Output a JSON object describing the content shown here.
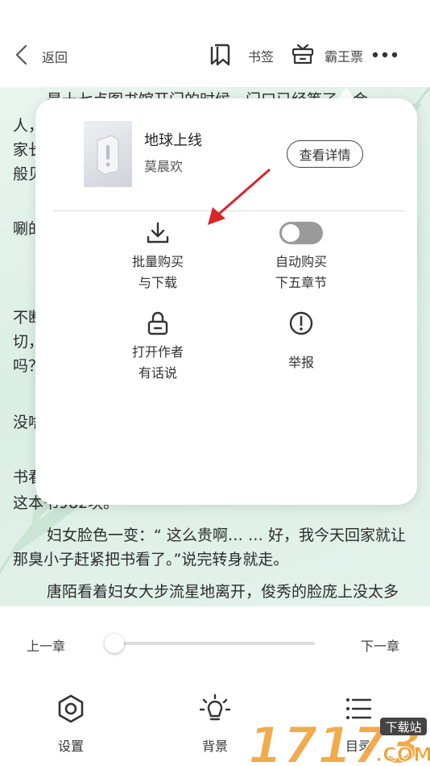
{
  "topbar": {
    "back_label": "返回",
    "bookmark_label": "书签",
    "ticket_label": "霸王票"
  },
  "reading": {
    "lines": [
      "是十七点图书馆开门的时候，门口已经等了一会",
      "人，",
      "家长",
      "般见",
      "唰的",
      "不断",
      "切，",
      "吗？",
      "没啥",
      "书看",
      "这本书982块。",
      "妇女脸色一变：“ 这么贵啊… … 好，我今天回家就让",
      "那臭小子赶紧把书看了。”说完转身就走。",
      "唐陌看着妇女大步流星地离开，俊秀的脸庞上没太多"
    ]
  },
  "popup": {
    "book_title": "地球上线",
    "book_author": "莫晨欢",
    "detail_button": "查看详情",
    "batch_line1": "批量购买",
    "batch_line2": "与下载",
    "auto_line1": "自动购买",
    "auto_line2": "下五章节",
    "auto_buy_on": false,
    "author_line1": "打开作者",
    "author_line2": "有话说",
    "report_label": "举报"
  },
  "bottom": {
    "prev_chapter": "上一章",
    "next_chapter": "下一章",
    "progress": 0,
    "settings_label": "设置",
    "background_label": "背景",
    "catalog_label": "目录"
  },
  "watermark": {
    "number": "17173",
    "tag": "下载站",
    "domain": ".COM"
  },
  "colors": {
    "reading_bg": "#dcefe4",
    "arrow": "#d9252a",
    "watermark": "#f0a23a"
  }
}
